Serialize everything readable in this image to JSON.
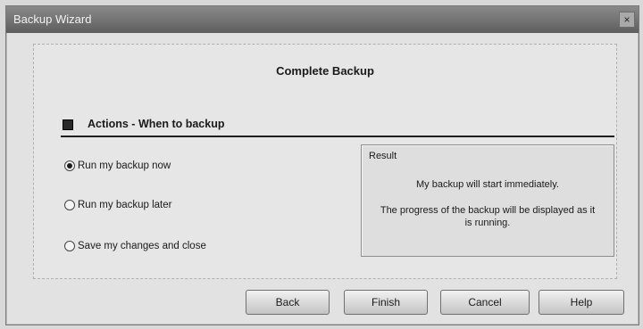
{
  "window": {
    "title": "Backup Wizard",
    "close_glyph": "×"
  },
  "wizard": {
    "heading": "Complete Backup"
  },
  "section": {
    "title": "Actions - When to backup"
  },
  "options": [
    {
      "label": "Run my backup now",
      "selected": true
    },
    {
      "label": "Run my backup later",
      "selected": false
    },
    {
      "label": "Save my changes and close",
      "selected": false
    }
  ],
  "result": {
    "label": "Result",
    "line1": "My backup will start immediately.",
    "line2": "The progress of the backup will be displayed as it is running."
  },
  "buttons": {
    "back": "Back",
    "finish": "Finish",
    "cancel": "Cancel",
    "help": "Help"
  }
}
